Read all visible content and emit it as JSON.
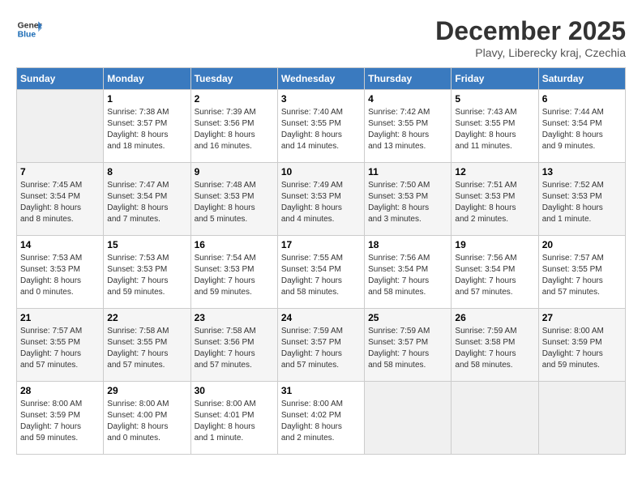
{
  "header": {
    "logo_line1": "General",
    "logo_line2": "Blue",
    "month": "December 2025",
    "location": "Plavy, Liberecky kraj, Czechia"
  },
  "days_of_week": [
    "Sunday",
    "Monday",
    "Tuesday",
    "Wednesday",
    "Thursday",
    "Friday",
    "Saturday"
  ],
  "weeks": [
    [
      {
        "num": "",
        "detail": ""
      },
      {
        "num": "1",
        "detail": "Sunrise: 7:38 AM\nSunset: 3:57 PM\nDaylight: 8 hours\nand 18 minutes."
      },
      {
        "num": "2",
        "detail": "Sunrise: 7:39 AM\nSunset: 3:56 PM\nDaylight: 8 hours\nand 16 minutes."
      },
      {
        "num": "3",
        "detail": "Sunrise: 7:40 AM\nSunset: 3:55 PM\nDaylight: 8 hours\nand 14 minutes."
      },
      {
        "num": "4",
        "detail": "Sunrise: 7:42 AM\nSunset: 3:55 PM\nDaylight: 8 hours\nand 13 minutes."
      },
      {
        "num": "5",
        "detail": "Sunrise: 7:43 AM\nSunset: 3:55 PM\nDaylight: 8 hours\nand 11 minutes."
      },
      {
        "num": "6",
        "detail": "Sunrise: 7:44 AM\nSunset: 3:54 PM\nDaylight: 8 hours\nand 9 minutes."
      }
    ],
    [
      {
        "num": "7",
        "detail": "Sunrise: 7:45 AM\nSunset: 3:54 PM\nDaylight: 8 hours\nand 8 minutes."
      },
      {
        "num": "8",
        "detail": "Sunrise: 7:47 AM\nSunset: 3:54 PM\nDaylight: 8 hours\nand 7 minutes."
      },
      {
        "num": "9",
        "detail": "Sunrise: 7:48 AM\nSunset: 3:53 PM\nDaylight: 8 hours\nand 5 minutes."
      },
      {
        "num": "10",
        "detail": "Sunrise: 7:49 AM\nSunset: 3:53 PM\nDaylight: 8 hours\nand 4 minutes."
      },
      {
        "num": "11",
        "detail": "Sunrise: 7:50 AM\nSunset: 3:53 PM\nDaylight: 8 hours\nand 3 minutes."
      },
      {
        "num": "12",
        "detail": "Sunrise: 7:51 AM\nSunset: 3:53 PM\nDaylight: 8 hours\nand 2 minutes."
      },
      {
        "num": "13",
        "detail": "Sunrise: 7:52 AM\nSunset: 3:53 PM\nDaylight: 8 hours\nand 1 minute."
      }
    ],
    [
      {
        "num": "14",
        "detail": "Sunrise: 7:53 AM\nSunset: 3:53 PM\nDaylight: 8 hours\nand 0 minutes."
      },
      {
        "num": "15",
        "detail": "Sunrise: 7:53 AM\nSunset: 3:53 PM\nDaylight: 7 hours\nand 59 minutes."
      },
      {
        "num": "16",
        "detail": "Sunrise: 7:54 AM\nSunset: 3:53 PM\nDaylight: 7 hours\nand 59 minutes."
      },
      {
        "num": "17",
        "detail": "Sunrise: 7:55 AM\nSunset: 3:54 PM\nDaylight: 7 hours\nand 58 minutes."
      },
      {
        "num": "18",
        "detail": "Sunrise: 7:56 AM\nSunset: 3:54 PM\nDaylight: 7 hours\nand 58 minutes."
      },
      {
        "num": "19",
        "detail": "Sunrise: 7:56 AM\nSunset: 3:54 PM\nDaylight: 7 hours\nand 57 minutes."
      },
      {
        "num": "20",
        "detail": "Sunrise: 7:57 AM\nSunset: 3:55 PM\nDaylight: 7 hours\nand 57 minutes."
      }
    ],
    [
      {
        "num": "21",
        "detail": "Sunrise: 7:57 AM\nSunset: 3:55 PM\nDaylight: 7 hours\nand 57 minutes."
      },
      {
        "num": "22",
        "detail": "Sunrise: 7:58 AM\nSunset: 3:55 PM\nDaylight: 7 hours\nand 57 minutes."
      },
      {
        "num": "23",
        "detail": "Sunrise: 7:58 AM\nSunset: 3:56 PM\nDaylight: 7 hours\nand 57 minutes."
      },
      {
        "num": "24",
        "detail": "Sunrise: 7:59 AM\nSunset: 3:57 PM\nDaylight: 7 hours\nand 57 minutes."
      },
      {
        "num": "25",
        "detail": "Sunrise: 7:59 AM\nSunset: 3:57 PM\nDaylight: 7 hours\nand 58 minutes."
      },
      {
        "num": "26",
        "detail": "Sunrise: 7:59 AM\nSunset: 3:58 PM\nDaylight: 7 hours\nand 58 minutes."
      },
      {
        "num": "27",
        "detail": "Sunrise: 8:00 AM\nSunset: 3:59 PM\nDaylight: 7 hours\nand 59 minutes."
      }
    ],
    [
      {
        "num": "28",
        "detail": "Sunrise: 8:00 AM\nSunset: 3:59 PM\nDaylight: 7 hours\nand 59 minutes."
      },
      {
        "num": "29",
        "detail": "Sunrise: 8:00 AM\nSunset: 4:00 PM\nDaylight: 8 hours\nand 0 minutes."
      },
      {
        "num": "30",
        "detail": "Sunrise: 8:00 AM\nSunset: 4:01 PM\nDaylight: 8 hours\nand 1 minute."
      },
      {
        "num": "31",
        "detail": "Sunrise: 8:00 AM\nSunset: 4:02 PM\nDaylight: 8 hours\nand 2 minutes."
      },
      {
        "num": "",
        "detail": ""
      },
      {
        "num": "",
        "detail": ""
      },
      {
        "num": "",
        "detail": ""
      }
    ]
  ]
}
